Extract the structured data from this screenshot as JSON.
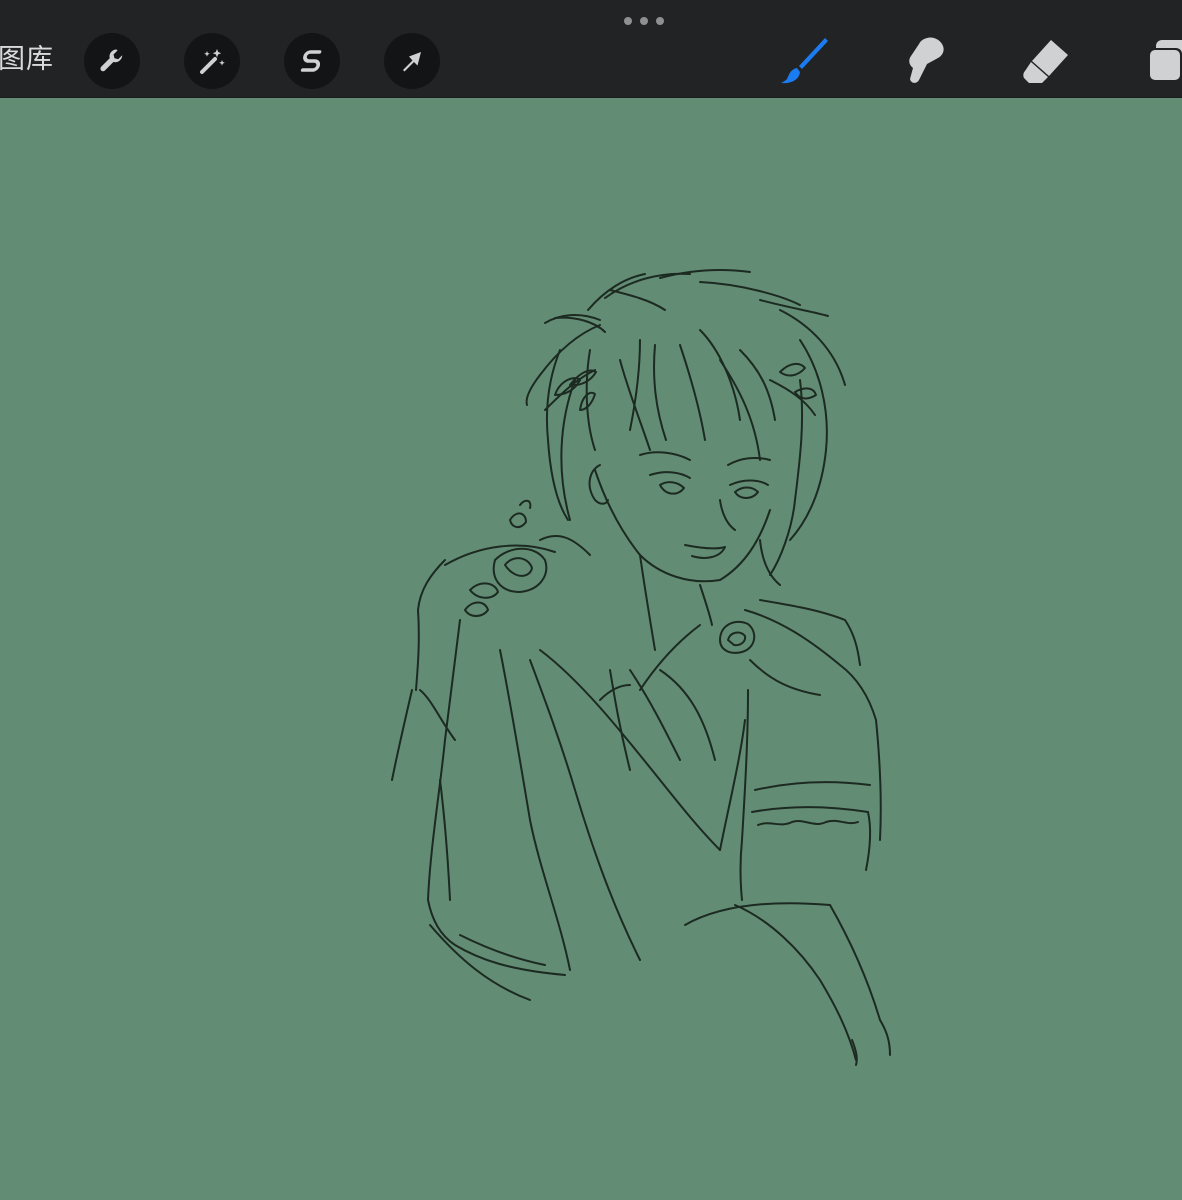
{
  "toolbar": {
    "gallery_label": "图库",
    "left_tools": [
      {
        "name": "actions",
        "icon": "wrench-icon"
      },
      {
        "name": "adjustments",
        "icon": "magic-wand-icon"
      },
      {
        "name": "selection",
        "icon": "selection-s-icon"
      },
      {
        "name": "transform",
        "icon": "arrow-cursor-icon"
      }
    ],
    "right_tools": [
      {
        "name": "brush",
        "icon": "brush-icon",
        "active": true
      },
      {
        "name": "smudge",
        "icon": "smudge-finger-icon",
        "active": false
      },
      {
        "name": "eraser",
        "icon": "eraser-icon",
        "active": false
      },
      {
        "name": "layers",
        "icon": "layers-icon",
        "active": false
      }
    ],
    "colors": {
      "bar": "#212325",
      "active_tool": "#1a7cf0",
      "icon": "#cfd1d3"
    }
  },
  "canvas": {
    "background": "#628c74",
    "stroke_color": "#1c2a21"
  }
}
